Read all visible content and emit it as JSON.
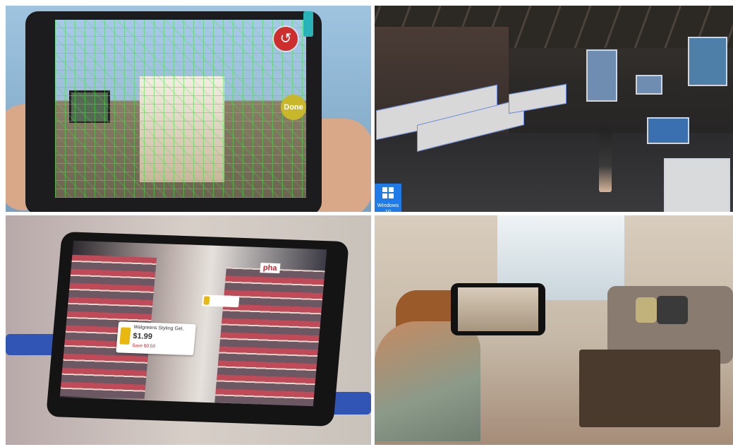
{
  "panels": {
    "ar_scan": {
      "buttons": {
        "reset_icon": "↺",
        "done_label": "Done"
      },
      "colors": {
        "mesh": "#3ce63c",
        "reset": "#cf2e2e",
        "done": "#c8b72a",
        "clip": "#28b3b8"
      }
    },
    "vr_warehouse": {
      "badge": {
        "icon": "windows-logo-icon",
        "label": "Windows 10"
      },
      "colors": {
        "badge": "#1f7be8",
        "wireframe": "#6a8be0"
      }
    },
    "retail_ar": {
      "price_tag": {
        "product": "Walgreens Styling Gel,",
        "price": "$1.99",
        "savings": "Save $0.50"
      },
      "store_sign": "pha"
    },
    "living_room": {}
  }
}
